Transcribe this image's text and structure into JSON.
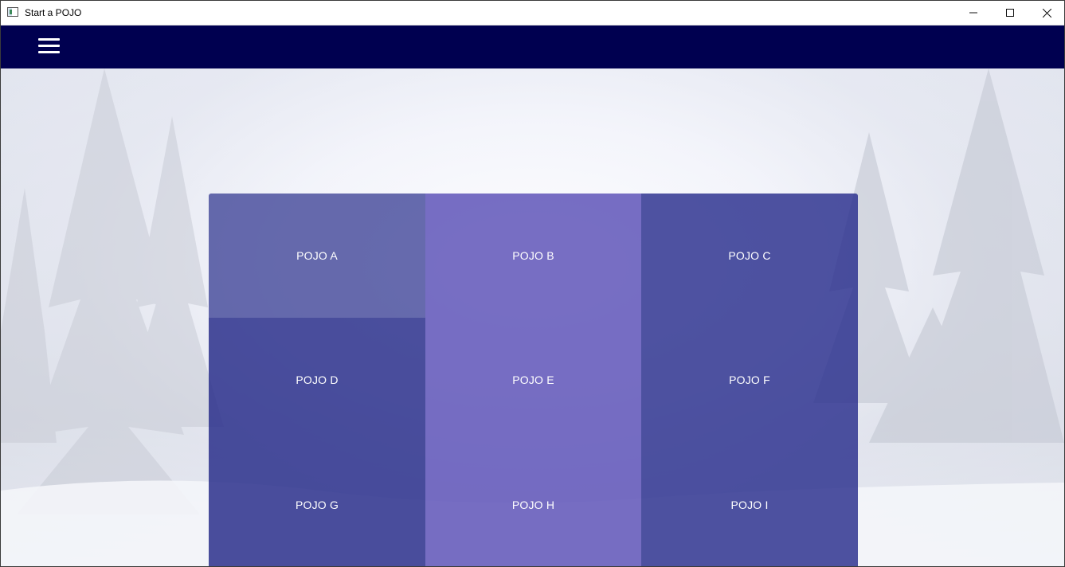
{
  "window": {
    "title": "Start a POJO"
  },
  "titlebar_icons": {
    "app": "app-window-icon",
    "minimize": "minimize-icon",
    "maximize": "maximize-icon",
    "close": "close-icon"
  },
  "header": {
    "menu_icon": "hamburger-menu-icon",
    "background_color": "#000050"
  },
  "tiles": [
    {
      "label": "POJO A"
    },
    {
      "label": "POJO B"
    },
    {
      "label": "POJO C"
    },
    {
      "label": "POJO D"
    },
    {
      "label": "POJO E"
    },
    {
      "label": "POJO F"
    },
    {
      "label": "POJO G"
    },
    {
      "label": "POJO H"
    },
    {
      "label": "POJO I"
    }
  ]
}
